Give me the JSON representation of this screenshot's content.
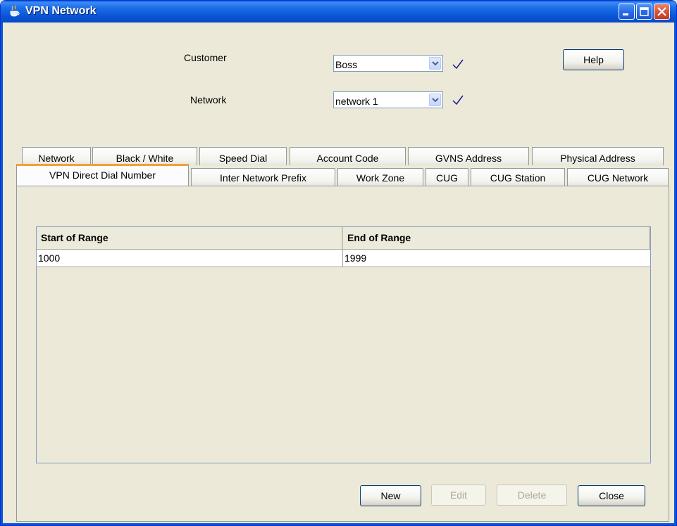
{
  "window": {
    "title": "VPN Network",
    "icon": "java-cup-icon"
  },
  "form": {
    "customer_label": "Customer",
    "customer_value": "Boss",
    "network_label": "Network",
    "network_value": "network 1",
    "help_label": "Help"
  },
  "tabs_back": [
    {
      "label": "Network"
    },
    {
      "label": "Black / White"
    },
    {
      "label": "Speed Dial"
    },
    {
      "label": "Account Code"
    },
    {
      "label": "GVNS Address"
    },
    {
      "label": "Physical Address"
    }
  ],
  "tabs_front": [
    {
      "label": "VPN Direct Dial Number",
      "active": true
    },
    {
      "label": "Inter Network Prefix"
    },
    {
      "label": "Work Zone"
    },
    {
      "label": "CUG"
    },
    {
      "label": "CUG Station"
    },
    {
      "label": "CUG Network"
    }
  ],
  "table": {
    "columns": [
      "Start of Range",
      "End of Range"
    ],
    "rows": [
      [
        "1000",
        "1999"
      ]
    ]
  },
  "buttons": {
    "new": "New",
    "edit": "Edit",
    "delete": "Delete",
    "close": "Close"
  },
  "colors": {
    "titlebar": "#0a55d6",
    "active_tab_accent": "#f1a238",
    "check": "#1a1a8c"
  }
}
